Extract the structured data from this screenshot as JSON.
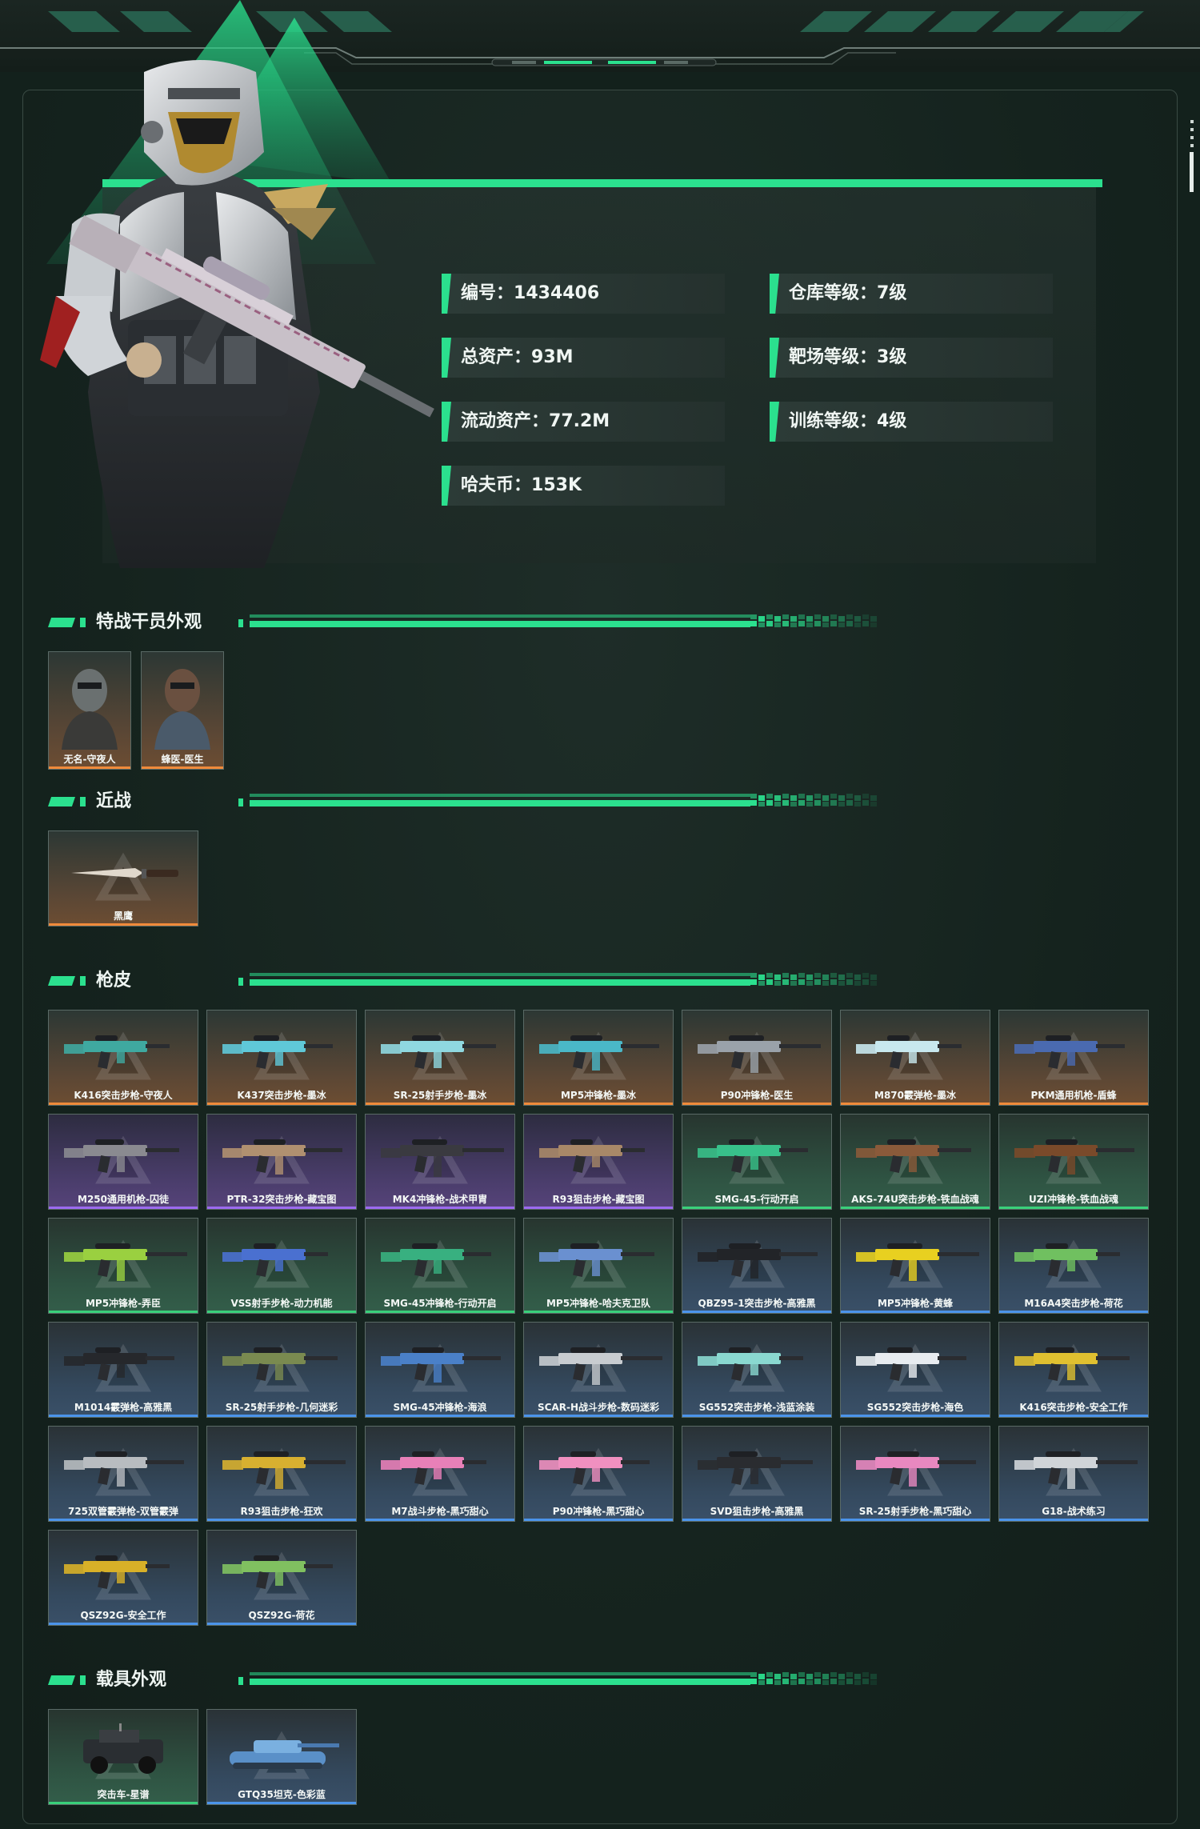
{
  "profile": {
    "stats": [
      {
        "label": "编号：",
        "value": "1434406"
      },
      {
        "label": "仓库等级：",
        "value": "7级"
      },
      {
        "label": "总资产：",
        "value": "93M"
      },
      {
        "label": "靶场等级：",
        "value": "3级"
      },
      {
        "label": "流动资产：",
        "value": "77.2M"
      },
      {
        "label": "训练等级：",
        "value": "4级"
      },
      {
        "label": "哈夫币：",
        "value": "153K"
      }
    ]
  },
  "sections": {
    "operators": {
      "title": "特战干员外观",
      "items": [
        {
          "name": "无名-守夜人",
          "rarity": "orange"
        },
        {
          "name": "蜂医-医生",
          "rarity": "orange"
        }
      ]
    },
    "melee": {
      "title": "近战",
      "items": [
        {
          "name": "黑鹰",
          "rarity": "orange"
        }
      ]
    },
    "skins": {
      "title": "枪皮",
      "items": [
        {
          "name": "K416突击步枪-守夜人",
          "rarity": "orange",
          "color": "#3fa9a0"
        },
        {
          "name": "K437突击步枪-墨冰",
          "rarity": "orange",
          "color": "#5fc8d8"
        },
        {
          "name": "SR-25射手步枪-墨冰",
          "rarity": "orange",
          "color": "#8fd8e0"
        },
        {
          "name": "MP5冲锋枪-墨冰",
          "rarity": "orange",
          "color": "#4ab8c8"
        },
        {
          "name": "P90冲锋枪-医生",
          "rarity": "orange",
          "color": "#9aa2aa"
        },
        {
          "name": "M870霰弹枪-墨冰",
          "rarity": "orange",
          "color": "#c8e8ee"
        },
        {
          "name": "PKM通用机枪-盾蜂",
          "rarity": "orange",
          "color": "#4a6ab0"
        },
        {
          "name": "M250通用机枪-囚徒",
          "rarity": "purple",
          "color": "#8a8a90"
        },
        {
          "name": "PTR-32突击步枪-藏宝图",
          "rarity": "purple",
          "color": "#b09070"
        },
        {
          "name": "MK4冲锋枪-战术甲胄",
          "rarity": "purple",
          "color": "#3a3a40"
        },
        {
          "name": "R93狙击步枪-藏宝图",
          "rarity": "purple",
          "color": "#a88868"
        },
        {
          "name": "SMG-45-行动开启",
          "rarity": "green",
          "color": "#38c08a"
        },
        {
          "name": "AKS-74U突击步枪-铁血战魂",
          "rarity": "green",
          "color": "#8a5a3a"
        },
        {
          "name": "UZI冲锋枪-铁血战魂",
          "rarity": "green",
          "color": "#7a4a2a"
        },
        {
          "name": "MP5冲锋枪-弄臣",
          "rarity": "green",
          "color": "#9ad040"
        },
        {
          "name": "VSS射手步枪-动力机能",
          "rarity": "green",
          "color": "#4a70d0"
        },
        {
          "name": "SMG-45冲锋枪-行动开启",
          "rarity": "green",
          "color": "#38b080"
        },
        {
          "name": "MP5冲锋枪-哈夫克卫队",
          "rarity": "green",
          "color": "#6a90d0"
        },
        {
          "name": "QBZ95-1突击步枪-高雅黑",
          "rarity": "blue",
          "color": "#222428"
        },
        {
          "name": "MP5冲锋枪-黄蜂",
          "rarity": "blue",
          "color": "#e8d020"
        },
        {
          "name": "M16A4突击步枪-荷花",
          "rarity": "blue",
          "color": "#70c060"
        },
        {
          "name": "M1014霰弹枪-高雅黑",
          "rarity": "blue",
          "color": "#26282c"
        },
        {
          "name": "SR-25射手步枪-几何迷彩",
          "rarity": "blue",
          "color": "#7a8a50"
        },
        {
          "name": "SMG-45冲锋枪-海浪",
          "rarity": "blue",
          "color": "#4a80c8"
        },
        {
          "name": "SCAR-H战斗步枪-数码迷彩",
          "rarity": "blue",
          "color": "#c8ccd0"
        },
        {
          "name": "SG552突击步枪-浅蓝涂装",
          "rarity": "blue",
          "color": "#8ad8d0"
        },
        {
          "name": "SG552突击步枪-海色",
          "rarity": "blue",
          "color": "#e8ecf0"
        },
        {
          "name": "K416突击步枪-安全工作",
          "rarity": "blue",
          "color": "#e0c030"
        },
        {
          "name": "725双管霰弹枪-双管霰弹",
          "rarity": "blue",
          "color": "#b8bcc0"
        },
        {
          "name": "R93狙击步枪-狂欢",
          "rarity": "blue",
          "color": "#d8b030"
        },
        {
          "name": "M7战斗步枪-黑巧甜心",
          "rarity": "blue",
          "color": "#e880b8"
        },
        {
          "name": "P90冲锋枪-黑巧甜心",
          "rarity": "blue",
          "color": "#f090c0"
        },
        {
          "name": "SVD狙击步枪-高雅黑",
          "rarity": "blue",
          "color": "#2a2c30"
        },
        {
          "name": "SR-25射手步枪-黑巧甜心",
          "rarity": "blue",
          "color": "#e888c0"
        },
        {
          "name": "G18-战术练习",
          "rarity": "blue",
          "color": "#d0d4d8"
        },
        {
          "name": "QSZ92G-安全工作",
          "rarity": "blue",
          "color": "#d8b028"
        },
        {
          "name": "QSZ92G-荷花",
          "rarity": "blue",
          "color": "#80c060"
        }
      ]
    },
    "vehicles": {
      "title": "载具外观",
      "items": [
        {
          "name": "突击车-星谱",
          "rarity": "green"
        },
        {
          "name": "GTQ35坦克-色彩蓝",
          "rarity": "blue"
        }
      ]
    }
  },
  "colors": {
    "accent": "#2be08e",
    "rarity_orange": "#f08a3a",
    "rarity_purple": "#9b6af0",
    "rarity_green": "#39d07a",
    "rarity_blue": "#4b94ea"
  }
}
